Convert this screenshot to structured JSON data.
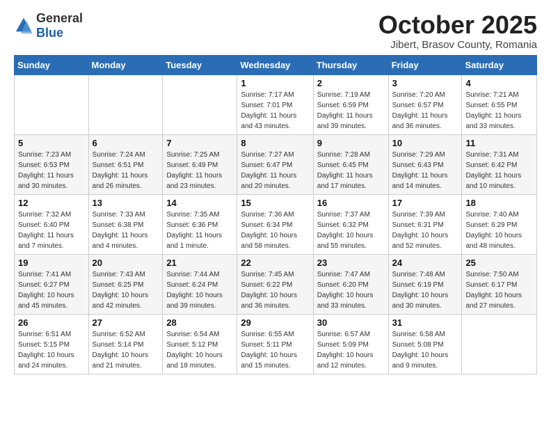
{
  "header": {
    "logo_general": "General",
    "logo_blue": "Blue",
    "month_title": "October 2025",
    "subtitle": "Jibert, Brasov County, Romania"
  },
  "weekdays": [
    "Sunday",
    "Monday",
    "Tuesday",
    "Wednesday",
    "Thursday",
    "Friday",
    "Saturday"
  ],
  "weeks": [
    [
      {
        "day": "",
        "info": ""
      },
      {
        "day": "",
        "info": ""
      },
      {
        "day": "",
        "info": ""
      },
      {
        "day": "1",
        "info": "Sunrise: 7:17 AM\nSunset: 7:01 PM\nDaylight: 11 hours\nand 43 minutes."
      },
      {
        "day": "2",
        "info": "Sunrise: 7:19 AM\nSunset: 6:59 PM\nDaylight: 11 hours\nand 39 minutes."
      },
      {
        "day": "3",
        "info": "Sunrise: 7:20 AM\nSunset: 6:57 PM\nDaylight: 11 hours\nand 36 minutes."
      },
      {
        "day": "4",
        "info": "Sunrise: 7:21 AM\nSunset: 6:55 PM\nDaylight: 11 hours\nand 33 minutes."
      }
    ],
    [
      {
        "day": "5",
        "info": "Sunrise: 7:23 AM\nSunset: 6:53 PM\nDaylight: 11 hours\nand 30 minutes."
      },
      {
        "day": "6",
        "info": "Sunrise: 7:24 AM\nSunset: 6:51 PM\nDaylight: 11 hours\nand 26 minutes."
      },
      {
        "day": "7",
        "info": "Sunrise: 7:25 AM\nSunset: 6:49 PM\nDaylight: 11 hours\nand 23 minutes."
      },
      {
        "day": "8",
        "info": "Sunrise: 7:27 AM\nSunset: 6:47 PM\nDaylight: 11 hours\nand 20 minutes."
      },
      {
        "day": "9",
        "info": "Sunrise: 7:28 AM\nSunset: 6:45 PM\nDaylight: 11 hours\nand 17 minutes."
      },
      {
        "day": "10",
        "info": "Sunrise: 7:29 AM\nSunset: 6:43 PM\nDaylight: 11 hours\nand 14 minutes."
      },
      {
        "day": "11",
        "info": "Sunrise: 7:31 AM\nSunset: 6:42 PM\nDaylight: 11 hours\nand 10 minutes."
      }
    ],
    [
      {
        "day": "12",
        "info": "Sunrise: 7:32 AM\nSunset: 6:40 PM\nDaylight: 11 hours\nand 7 minutes."
      },
      {
        "day": "13",
        "info": "Sunrise: 7:33 AM\nSunset: 6:38 PM\nDaylight: 11 hours\nand 4 minutes."
      },
      {
        "day": "14",
        "info": "Sunrise: 7:35 AM\nSunset: 6:36 PM\nDaylight: 11 hours\nand 1 minute."
      },
      {
        "day": "15",
        "info": "Sunrise: 7:36 AM\nSunset: 6:34 PM\nDaylight: 10 hours\nand 58 minutes."
      },
      {
        "day": "16",
        "info": "Sunrise: 7:37 AM\nSunset: 6:32 PM\nDaylight: 10 hours\nand 55 minutes."
      },
      {
        "day": "17",
        "info": "Sunrise: 7:39 AM\nSunset: 6:31 PM\nDaylight: 10 hours\nand 52 minutes."
      },
      {
        "day": "18",
        "info": "Sunrise: 7:40 AM\nSunset: 6:29 PM\nDaylight: 10 hours\nand 48 minutes."
      }
    ],
    [
      {
        "day": "19",
        "info": "Sunrise: 7:41 AM\nSunset: 6:27 PM\nDaylight: 10 hours\nand 45 minutes."
      },
      {
        "day": "20",
        "info": "Sunrise: 7:43 AM\nSunset: 6:25 PM\nDaylight: 10 hours\nand 42 minutes."
      },
      {
        "day": "21",
        "info": "Sunrise: 7:44 AM\nSunset: 6:24 PM\nDaylight: 10 hours\nand 39 minutes."
      },
      {
        "day": "22",
        "info": "Sunrise: 7:45 AM\nSunset: 6:22 PM\nDaylight: 10 hours\nand 36 minutes."
      },
      {
        "day": "23",
        "info": "Sunrise: 7:47 AM\nSunset: 6:20 PM\nDaylight: 10 hours\nand 33 minutes."
      },
      {
        "day": "24",
        "info": "Sunrise: 7:48 AM\nSunset: 6:19 PM\nDaylight: 10 hours\nand 30 minutes."
      },
      {
        "day": "25",
        "info": "Sunrise: 7:50 AM\nSunset: 6:17 PM\nDaylight: 10 hours\nand 27 minutes."
      }
    ],
    [
      {
        "day": "26",
        "info": "Sunrise: 6:51 AM\nSunset: 5:15 PM\nDaylight: 10 hours\nand 24 minutes."
      },
      {
        "day": "27",
        "info": "Sunrise: 6:52 AM\nSunset: 5:14 PM\nDaylight: 10 hours\nand 21 minutes."
      },
      {
        "day": "28",
        "info": "Sunrise: 6:54 AM\nSunset: 5:12 PM\nDaylight: 10 hours\nand 18 minutes."
      },
      {
        "day": "29",
        "info": "Sunrise: 6:55 AM\nSunset: 5:11 PM\nDaylight: 10 hours\nand 15 minutes."
      },
      {
        "day": "30",
        "info": "Sunrise: 6:57 AM\nSunset: 5:09 PM\nDaylight: 10 hours\nand 12 minutes."
      },
      {
        "day": "31",
        "info": "Sunrise: 6:58 AM\nSunset: 5:08 PM\nDaylight: 10 hours\nand 9 minutes."
      },
      {
        "day": "",
        "info": ""
      }
    ]
  ]
}
